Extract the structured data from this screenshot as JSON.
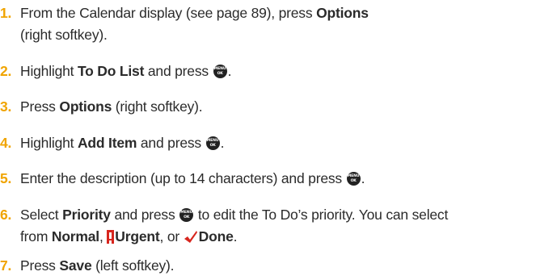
{
  "steps": [
    {
      "num": "1.",
      "parts": [
        "From the Calendar display (see page 89), press ",
        "Options"
      ],
      "cont": "(right softkey)."
    },
    {
      "num": "2.",
      "parts": [
        "Highlight ",
        "To Do List",
        " and press ",
        "."
      ]
    },
    {
      "num": "3.",
      "parts": [
        "Press ",
        "Options",
        " (right softkey)."
      ]
    },
    {
      "num": "4.",
      "parts": [
        "Highlight ",
        "Add Item",
        " and press ",
        "."
      ]
    },
    {
      "num": "5.",
      "parts": [
        "Enter the description (up to 14 characters) and press ",
        "."
      ]
    },
    {
      "num": "6.",
      "parts": [
        "Select ",
        "Priority",
        " and press ",
        " to edit the To Do’s priority. You can select"
      ],
      "cont_parts": [
        "from ",
        "Normal",
        ", ",
        "Urgent",
        ", or ",
        "Done",
        "."
      ]
    },
    {
      "num": "7.",
      "parts": [
        "Press ",
        "Save",
        " (left softkey)."
      ]
    }
  ],
  "icons": {
    "menu_ok_button": "menu-ok-button-icon",
    "urgent": "urgent-exclamation-icon",
    "done": "done-checkmark-icon"
  },
  "colors": {
    "step_number": "#f0a400",
    "text": "#2b2b2b",
    "urgent": "#d7261e"
  }
}
